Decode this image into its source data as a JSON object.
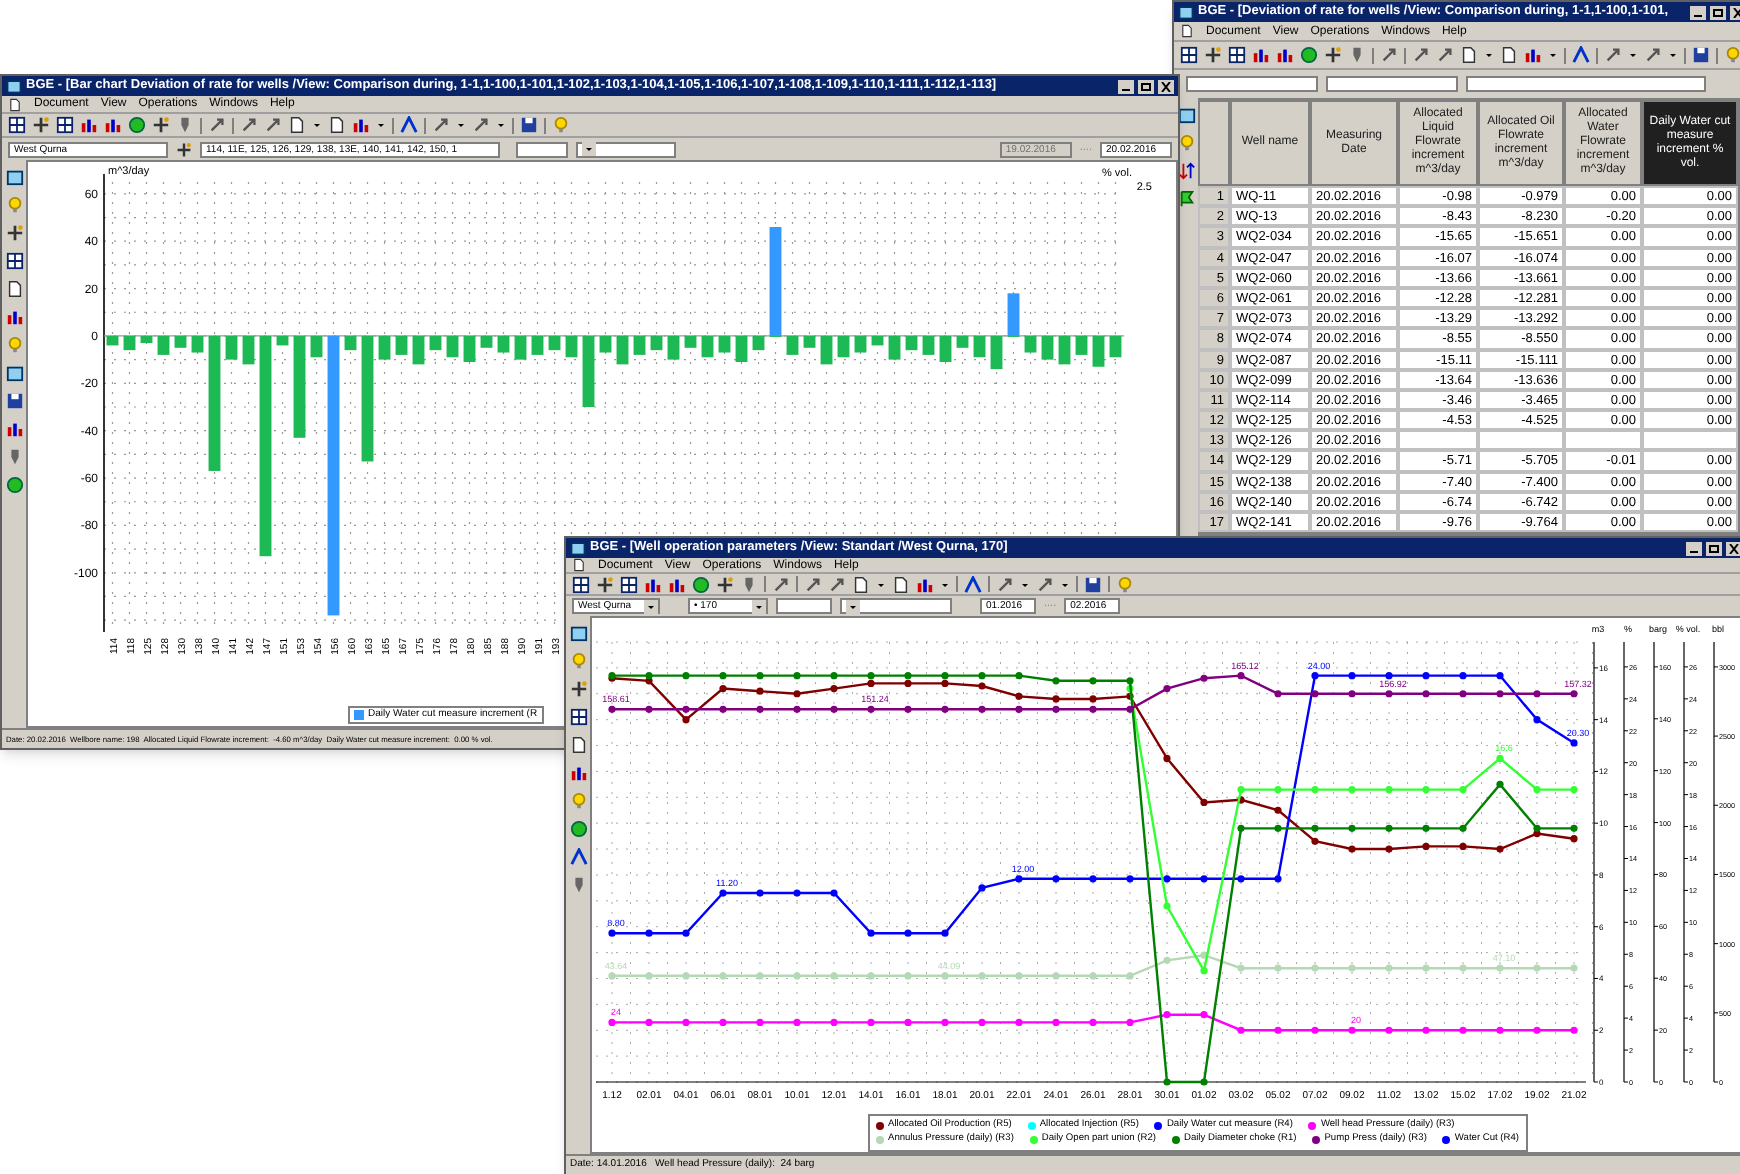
{
  "right_window": {
    "title": "BGE - [Deviation of rate for wells /View: Comparison during, 1-1,1-100,1-101,",
    "menu": [
      "Document",
      "View",
      "Operations",
      "Windows",
      "Help"
    ],
    "table": {
      "columns": [
        {
          "selected": false
        },
        {
          "label": "Well name",
          "selected": false
        },
        {
          "label": "Measuring Date",
          "selected": false
        },
        {
          "label": "Allocated Liquid Flowrate increment m^3/day",
          "selected": false
        },
        {
          "label": "Allocated Oil Flowrate increment m^3/day",
          "selected": false
        },
        {
          "label": "Allocated Water Flowrate increment m^3/day",
          "selected": false
        },
        {
          "label": "Daily Water cut measure increment % vol.",
          "selected": true
        }
      ],
      "rows": [
        {
          "number": "1",
          "well_name": "WQ-11",
          "date": "20.02.2016",
          "liquid": "-0.98",
          "oil": "-0.979",
          "water": "0.00",
          "water_cut": "0.00"
        },
        {
          "number": "2",
          "well_name": "WQ-13",
          "date": "20.02.2016",
          "liquid": "-8.43",
          "oil": "-8.230",
          "water": "-0.20",
          "water_cut": "0.00"
        },
        {
          "number": "3",
          "well_name": "WQ2-034",
          "date": "20.02.2016",
          "liquid": "-15.65",
          "oil": "-15.651",
          "water": "0.00",
          "water_cut": "0.00"
        },
        {
          "number": "4",
          "well_name": "WQ2-047",
          "date": "20.02.2016",
          "liquid": "-16.07",
          "oil": "-16.074",
          "water": "0.00",
          "water_cut": "0.00"
        },
        {
          "number": "5",
          "well_name": "WQ2-060",
          "date": "20.02.2016",
          "liquid": "-13.66",
          "oil": "-13.661",
          "water": "0.00",
          "water_cut": "0.00"
        },
        {
          "number": "6",
          "well_name": "WQ2-061",
          "date": "20.02.2016",
          "liquid": "-12.28",
          "oil": "-12.281",
          "water": "0.00",
          "water_cut": "0.00"
        },
        {
          "number": "7",
          "well_name": "WQ2-073",
          "date": "20.02.2016",
          "liquid": "-13.29",
          "oil": "-13.292",
          "water": "0.00",
          "water_cut": "0.00"
        },
        {
          "number": "8",
          "well_name": "WQ2-074",
          "date": "20.02.2016",
          "liquid": "-8.55",
          "oil": "-8.550",
          "water": "0.00",
          "water_cut": "0.00"
        },
        {
          "number": "9",
          "well_name": "WQ2-087",
          "date": "20.02.2016",
          "liquid": "-15.11",
          "oil": "-15.111",
          "water": "0.00",
          "water_cut": "0.00"
        },
        {
          "number": "10",
          "well_name": "WQ2-099",
          "date": "20.02.2016",
          "liquid": "-13.64",
          "oil": "-13.636",
          "water": "0.00",
          "water_cut": "0.00"
        },
        {
          "number": "11",
          "well_name": "WQ2-114",
          "date": "20.02.2016",
          "liquid": "-3.46",
          "oil": "-3.465",
          "water": "0.00",
          "water_cut": "0.00"
        },
        {
          "number": "12",
          "well_name": "WQ2-125",
          "date": "20.02.2016",
          "liquid": "-4.53",
          "oil": "-4.525",
          "water": "0.00",
          "water_cut": "0.00"
        },
        {
          "number": "13",
          "well_name": "WQ2-126",
          "date": "20.02.2016"
        },
        {
          "number": "14",
          "well_name": "WQ2-129",
          "date": "20.02.2016",
          "liquid": "-5.71",
          "oil": "-5.705",
          "water": "-0.01",
          "water_cut": "0.00"
        },
        {
          "number": "15",
          "well_name": "WQ2-138",
          "date": "20.02.2016",
          "liquid": "-7.40",
          "oil": "-7.400",
          "water": "0.00",
          "water_cut": "0.00"
        },
        {
          "number": "16",
          "well_name": "WQ2-140",
          "date": "20.02.2016",
          "liquid": "-6.74",
          "oil": "-6.742",
          "water": "0.00",
          "water_cut": "0.00"
        },
        {
          "number": "17",
          "well_name": "WQ2-141",
          "date": "20.02.2016",
          "liquid": "-9.76",
          "oil": "-9.764",
          "water": "0.00",
          "water_cut": "0.00"
        }
      ]
    }
  },
  "left_window": {
    "title": "BGE - [Bar chart Deviation of rate for wells /View: Comparison during, 1-1,1-100,1-101,1-102,1-103,1-104,1-105,1-106,1-107,1-108,1-109,1-110,1-111,1-112,1-113]",
    "menu": [
      "Document",
      "View",
      "Operations",
      "Windows",
      "Help"
    ],
    "filters": {
      "field": "West Qurna",
      "wells": "114, 11E, 125, 126, 129, 138, 13E, 140, 141, 142, 150, 1",
      "date_from": {
        "value": "19.02.2016",
        "disabled": true
      },
      "separator": "....",
      "date_to": "20.02.2016"
    },
    "chart": {
      "chart_data": {
        "type": "bar",
        "grid": true,
        "ylabel": "m^3/day",
        "y2label": "% vol.",
        "y2ticks": [
          "2.5"
        ],
        "ylim": [
          -125,
          65
        ],
        "yticks": [
          60,
          40,
          20,
          0,
          -20,
          -40,
          -60,
          -80,
          -100
        ],
        "categories": [
          "114",
          "118",
          "125",
          "128",
          "130",
          "138",
          "140",
          "141",
          "142",
          "147",
          "151",
          "153",
          "154",
          "156",
          "160",
          "163",
          "165",
          "167",
          "175",
          "176",
          "178",
          "180",
          "185",
          "188",
          "190",
          "191",
          "193",
          null,
          null,
          null,
          null,
          null,
          null,
          null,
          null,
          null,
          null,
          null,
          null,
          null,
          null,
          null,
          null,
          null,
          null,
          null,
          null,
          null,
          null,
          null,
          null,
          null,
          null,
          null,
          null,
          null,
          null,
          null,
          null,
          null
        ],
        "series": [
          {
            "color": "#1db954",
            "values": [
              -4,
              -6,
              -3,
              -8,
              -5,
              -7,
              -57,
              -10,
              -12,
              -93,
              -4,
              -43,
              -9,
              0,
              -6,
              -53,
              -10,
              -8,
              -12,
              -6,
              -9,
              -11,
              -5,
              -7,
              -10,
              -8,
              -6,
              -9,
              -30,
              -7,
              -12,
              -8,
              -6,
              -10,
              -5,
              -9,
              -7,
              -11,
              -6,
              0,
              -8,
              -5,
              -12,
              -9,
              -7,
              -4,
              -10,
              -6,
              -8,
              -11,
              -5,
              -9,
              -14,
              0,
              -7,
              -10,
              -12,
              -8,
              -13,
              -9
            ]
          },
          {
            "name": "Daily Water cut measure increment (R",
            "color": "#3399ff",
            "values": [
              null,
              null,
              null,
              null,
              null,
              null,
              null,
              null,
              null,
              null,
              null,
              null,
              null,
              -118,
              null,
              null,
              null,
              null,
              null,
              null,
              null,
              null,
              null,
              null,
              null,
              null,
              null,
              null,
              null,
              null,
              null,
              null,
              null,
              null,
              null,
              null,
              null,
              null,
              null,
              46,
              null,
              null,
              null,
              null,
              null,
              null,
              null,
              null,
              null,
              null,
              null,
              null,
              null,
              18,
              null,
              null,
              null,
              null,
              null,
              null
            ]
          }
        ]
      }
    },
    "status_bar": "Date: 20.02.2016  Wellbore name: 198  Allocated Liquid Flowrate increment:  -4.60 m^3/day  Daily Water cut measure increment:  0.00 % vol."
  },
  "bottom_window": {
    "title": "BGE - [Well operation parameters /View: Standart /West Qurna, 170]",
    "menu": [
      "Document",
      "View",
      "Operations",
      "Windows",
      "Help"
    ],
    "filters": {
      "field": "West Qurna",
      "well": "• 170",
      "date_from": "01.2016",
      "separator": "....",
      "date_to": "02.2016"
    },
    "chart": {
      "extra_axes": [
        {
          "label": "%",
          "ticks": [
            "26",
            "24",
            "22",
            "20",
            "18",
            "16",
            "14",
            "12",
            "10",
            "8",
            "6",
            "4",
            "2",
            "0"
          ]
        },
        {
          "label": "barg",
          "ticks": [
            "160",
            "140",
            "120",
            "100",
            "80",
            "60",
            "40",
            "20",
            "0"
          ]
        },
        {
          "label": "% vol.",
          "ticks": [
            "26",
            "24",
            "22",
            "20",
            "18",
            "16",
            "14",
            "12",
            "10",
            "8",
            "6",
            "4",
            "2",
            "0"
          ]
        },
        {
          "label": "bbl",
          "ticks": [
            "3000",
            "2500",
            "2000",
            "1500",
            "1000",
            "500",
            "0"
          ]
        }
      ],
      "chart_data": {
        "type": "line",
        "grid": true,
        "ylabel": "m3",
        "ylim": [
          0,
          17
        ],
        "yticks": [
          0,
          2,
          4,
          6,
          8,
          10,
          12,
          14,
          16
        ],
        "x": [
          "1.12",
          "02.01",
          "04.01",
          "06.01",
          "08.01",
          "10.01",
          "12.01",
          "14.01",
          "16.01",
          "18.01",
          "20.01",
          "22.01",
          "24.01",
          "26.01",
          "28.01",
          "30.01",
          "01.02",
          "03.02",
          "05.02",
          "07.02",
          "09.02",
          "11.02",
          "13.02",
          "15.02",
          "17.02",
          "19.02",
          "21.02"
        ],
        "series": [
          {
            "name": "Allocated Oil Production (R5)",
            "color": "#800000",
            "marker": "circle",
            "values": [
              15.6,
              15.5,
              14.0,
              15.2,
              15.1,
              15.0,
              15.2,
              15.4,
              15.4,
              15.4,
              15.3,
              14.9,
              14.8,
              14.8,
              14.9,
              12.5,
              10.8,
              10.9,
              10.5,
              9.3,
              9.0,
              9.0,
              9.1,
              9.1,
              9.0,
              9.6,
              9.4
            ]
          },
          {
            "name": "Allocated Injection (R5)",
            "color": "#00ffff",
            "marker": "circle",
            "values": [
              null,
              null,
              null,
              null,
              null,
              null,
              null,
              null,
              null,
              null,
              null,
              null,
              null,
              null,
              null,
              null,
              null,
              null,
              null,
              null,
              null,
              null,
              null,
              null,
              null,
              null,
              null
            ]
          },
          {
            "name": "Daily Water cut measure (R4)",
            "color": "#0000ff",
            "marker": "circle",
            "values": [
              5.75,
              5.75,
              5.75,
              7.3,
              7.3,
              7.3,
              7.3,
              5.75,
              5.75,
              5.75,
              7.5,
              7.85,
              7.85,
              7.85,
              7.85,
              7.85,
              7.85,
              7.85,
              7.85,
              15.7,
              15.7,
              15.7,
              15.7,
              15.7,
              15.7,
              14,
              13.1
            ]
          },
          {
            "name": "Well head Pressure (daily) (R3)",
            "color": "#ff00ff",
            "marker": "circle",
            "values": [
              2.3,
              2.3,
              2.3,
              2.3,
              2.3,
              2.3,
              2.3,
              2.3,
              2.3,
              2.3,
              2.3,
              2.3,
              2.3,
              2.3,
              2.3,
              2.6,
              2.6,
              2.0,
              2.0,
              2.0,
              2.0,
              2.0,
              2.0,
              2.0,
              2.0,
              2.0,
              2.0
            ]
          },
          {
            "name": "Annulus Pressure (daily) (R3)",
            "color": "#b5d8b5",
            "marker": "circle",
            "values": [
              4.1,
              4.1,
              4.1,
              4.1,
              4.1,
              4.1,
              4.1,
              4.1,
              4.1,
              4.1,
              4.1,
              4.1,
              4.1,
              4.1,
              4.1,
              4.7,
              4.9,
              4.4,
              4.4,
              4.4,
              4.4,
              4.4,
              4.4,
              4.4,
              4.4,
              4.4,
              4.4
            ]
          },
          {
            "name": "Daily Open part union (R2)",
            "color": "#33ff33",
            "marker": "circle",
            "values": [
              null,
              null,
              null,
              null,
              null,
              null,
              null,
              null,
              null,
              null,
              null,
              null,
              null,
              null,
              15.2,
              6.8,
              4.3,
              11.3,
              11.3,
              11.3,
              11.3,
              11.3,
              11.3,
              11.3,
              12.5,
              11.3,
              11.3
            ]
          },
          {
            "name": "Daily Diameter choke (R1)",
            "color": "#008000",
            "marker": "circle",
            "values": [
              15.7,
              15.7,
              15.7,
              15.7,
              15.7,
              15.7,
              15.7,
              15.7,
              15.7,
              15.7,
              15.7,
              15.7,
              15.5,
              15.5,
              15.5,
              0,
              0,
              9.8,
              9.8,
              9.8,
              9.8,
              9.8,
              9.8,
              9.8,
              11.5,
              9.8,
              9.8
            ]
          },
          {
            "name": "Pump Press (daily) (R3)",
            "color": "#800080",
            "marker": "circle",
            "values": [
              14.4,
              14.4,
              14.4,
              14.4,
              14.4,
              14.4,
              14.4,
              14.4,
              14.4,
              14.4,
              14.4,
              14.4,
              14.4,
              14.4,
              14.4,
              15.2,
              15.6,
              15.7,
              15.0,
              15.0,
              15.0,
              15.0,
              15.0,
              15.0,
              15.0,
              15.0,
              15.0
            ]
          },
          {
            "name": "Water Cut (R4)",
            "color": "#0000ff",
            "marker": "circle",
            "values": [
              null,
              null,
              null,
              null,
              null,
              null,
              null,
              null,
              null,
              null,
              null,
              null,
              null,
              null,
              null,
              null,
              null,
              null,
              null,
              null,
              null,
              null,
              null,
              null,
              null,
              null,
              null
            ]
          }
        ],
        "annotations": [
          {
            "text": "8.80",
            "x": "1.12",
            "y": 5.75
          },
          {
            "text": "11.20",
            "x": "06.01",
            "y": 7.3
          },
          {
            "text": "12.00",
            "x": "22.01",
            "y": 7.85
          },
          {
            "text": "24.00",
            "x": "07.02",
            "y": 15.7
          },
          {
            "text": "20.30",
            "x": "21.02",
            "y": 13.1
          },
          {
            "text": "158.61",
            "x": "1.12",
            "y": 14.4
          },
          {
            "text": "151.24",
            "x": "14.01",
            "y": 14.4
          },
          {
            "text": "165.12",
            "x": "03.02",
            "y": 15.7
          },
          {
            "text": "156.92",
            "x": "11.02",
            "y": 15.0
          },
          {
            "text": "157.32",
            "x": "21.02",
            "y": 15.0
          },
          {
            "text": "43.64",
            "x": "1.12",
            "y": 4.1
          },
          {
            "text": "44.09",
            "x": "18.01",
            "y": 4.1
          },
          {
            "text": "47.10",
            "x": "17.02",
            "y": 4.4
          },
          {
            "text": "24",
            "x": "1.12",
            "y": 2.3
          },
          {
            "text": "20",
            "x": "09.02",
            "y": 2.0
          },
          {
            "text": "16.6",
            "x": "17.02",
            "y": 12.5
          }
        ]
      }
    },
    "status_bar": "Date: 14.01.2016   Well head Pressure (daily):  24 barg"
  }
}
